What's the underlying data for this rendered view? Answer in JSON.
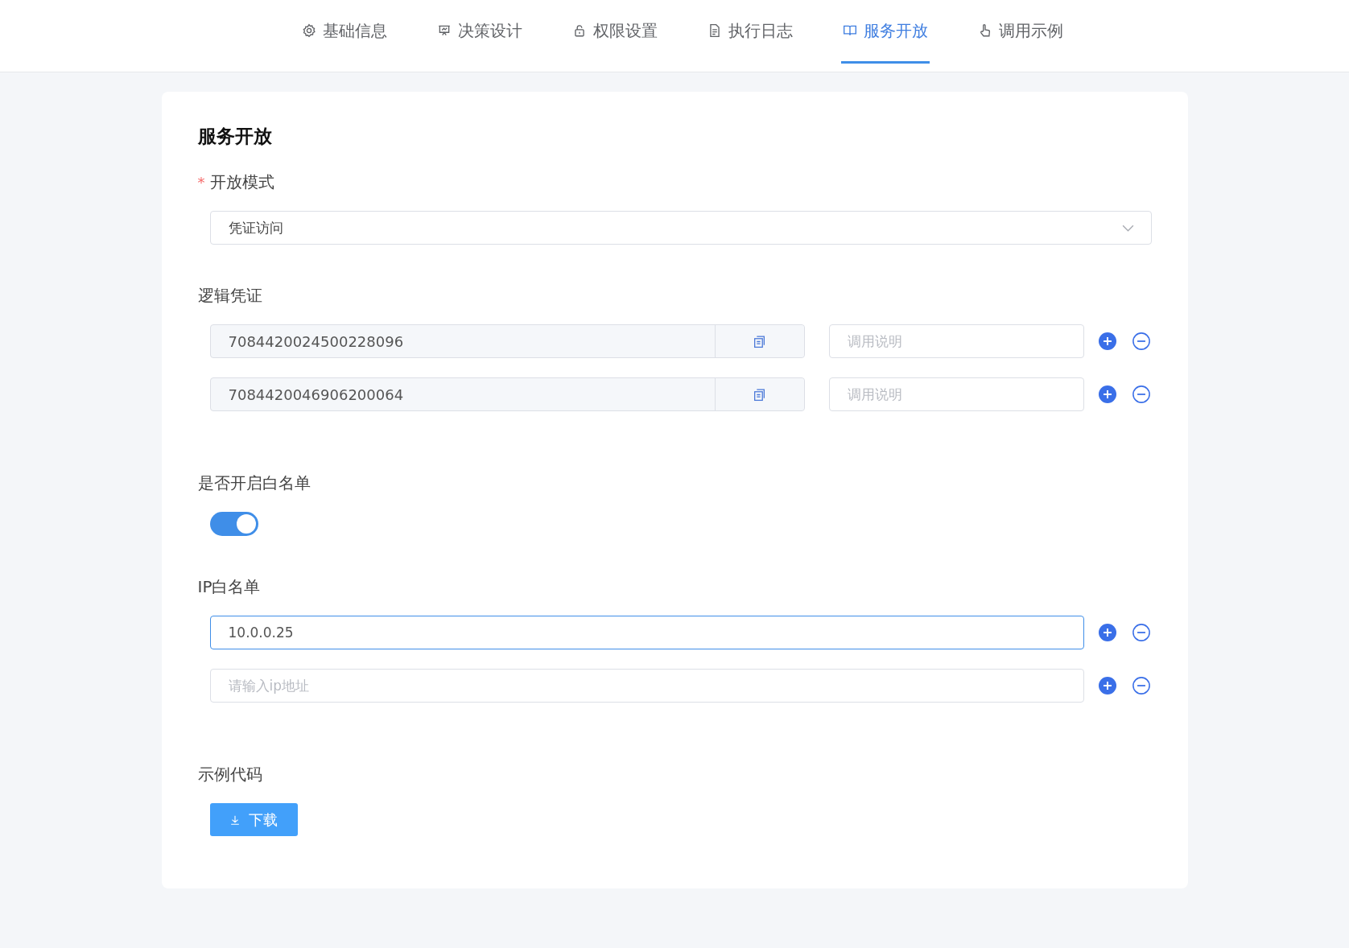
{
  "tabs": [
    {
      "label": "基础信息",
      "selected": false
    },
    {
      "label": "决策设计",
      "selected": false
    },
    {
      "label": "权限设置",
      "selected": false
    },
    {
      "label": "执行日志",
      "selected": false
    },
    {
      "label": "服务开放",
      "selected": true
    },
    {
      "label": "调用示例",
      "selected": false
    }
  ],
  "section_title": "服务开放",
  "open_mode": {
    "required_mark": "*",
    "label": "开放模式",
    "value": "凭证访问"
  },
  "credentials": {
    "label": "逻辑凭证",
    "rows": [
      {
        "value": "7084420024500228096",
        "description_placeholder": "调用说明"
      },
      {
        "value": "7084420046906200064",
        "description_placeholder": "调用说明"
      }
    ]
  },
  "whitelist_switch": {
    "label": "是否开启白名单",
    "on": true
  },
  "ip_whitelist": {
    "label": "IP白名单",
    "rows": [
      {
        "value": "10.0.0.25",
        "focused": true
      },
      {
        "value": "",
        "placeholder": "请输入ip地址",
        "focused": false
      }
    ]
  },
  "sample_code": {
    "label": "示例代码",
    "button": "下载"
  }
}
